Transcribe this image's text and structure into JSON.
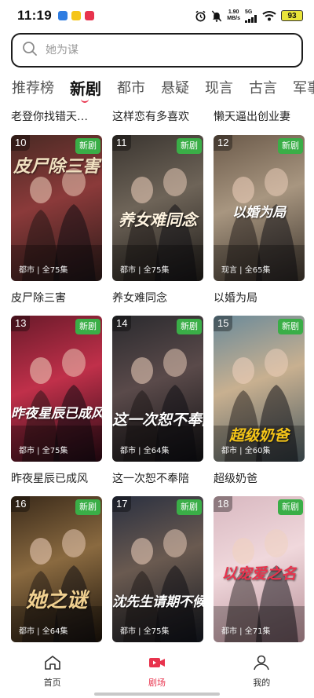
{
  "status_bar": {
    "time": "11:19",
    "net_speed_value": "1.90",
    "net_speed_unit": "MB/s",
    "signal_label": "5G",
    "battery": "93",
    "app_badge_colors": [
      "#2f7de1",
      "#f5c518",
      "#e8334d"
    ]
  },
  "search": {
    "placeholder": "她为谋",
    "icon": "search-icon"
  },
  "tabs": [
    {
      "label": "推荐榜",
      "active": false
    },
    {
      "label": "新剧",
      "active": true
    },
    {
      "label": "都市",
      "active": false
    },
    {
      "label": "悬疑",
      "active": false
    },
    {
      "label": "现言",
      "active": false
    },
    {
      "label": "古言",
      "active": false
    },
    {
      "label": "军事",
      "active": false
    }
  ],
  "top_row_titles": [
    "老登你找错天…",
    "这样恋有多喜欢",
    "懒天逼出创业妻"
  ],
  "badge_new": "新剧",
  "cards": [
    {
      "rank": "10",
      "genre": "都市",
      "episodes": "全75集",
      "title": "皮尸除三害",
      "art_text": "皮尸除三害",
      "colors": [
        "#4a2a24",
        "#8b3a3a",
        "#2a1a18"
      ],
      "art_color": "#f0e0c0"
    },
    {
      "rank": "11",
      "genre": "都市",
      "episodes": "全75集",
      "title": "养女难同念",
      "art_text": "养女难同念",
      "colors": [
        "#3a3530",
        "#6e6458",
        "#1e1b18"
      ],
      "art_color": "#fff4e0"
    },
    {
      "rank": "12",
      "genre": "现言",
      "episodes": "全65集",
      "title": "以婚为局",
      "art_text": "以婚为局",
      "colors": [
        "#6b5a4a",
        "#a89680",
        "#3c342c"
      ],
      "art_color": "#ffffff"
    },
    {
      "rank": "13",
      "genre": "都市",
      "episodes": "全75集",
      "title": "昨夜星辰已成风",
      "art_text": "昨夜星辰已成风",
      "colors": [
        "#6a1a2a",
        "#c0304a",
        "#2a0a14"
      ],
      "art_color": "#ffffff"
    },
    {
      "rank": "14",
      "genre": "都市",
      "episodes": "全64集",
      "title": "这一次恕不奉陪",
      "art_text": "这一次恕不奉陪",
      "colors": [
        "#2a2a2e",
        "#5a4a4a",
        "#101012"
      ],
      "art_color": "#ffffff"
    },
    {
      "rank": "15",
      "genre": "都市",
      "episodes": "全60集",
      "title": "超级奶爸",
      "art_text": "超级奶爸",
      "colors": [
        "#6a8a9a",
        "#c8b090",
        "#4a5a60"
      ],
      "art_color": "#f5c518"
    },
    {
      "rank": "16",
      "genre": "都市",
      "episodes": "全64集",
      "title": "",
      "art_text": "她之谜",
      "colors": [
        "#3a2a1a",
        "#8a6a40",
        "#1a120a"
      ],
      "art_color": "#f0d090"
    },
    {
      "rank": "17",
      "genre": "都市",
      "episodes": "全75集",
      "title": "",
      "art_text": "沈先生请期不候",
      "colors": [
        "#2a3040",
        "#6a5a50",
        "#141820"
      ],
      "art_color": "#ffffff"
    },
    {
      "rank": "18",
      "genre": "都市",
      "episodes": "全71集",
      "title": "",
      "art_text": "以宠爱之名",
      "colors": [
        "#d8b8c0",
        "#f0d8dc",
        "#b89098"
      ],
      "art_color": "#e8334d"
    }
  ],
  "bottom_nav": [
    {
      "label": "首页",
      "icon": "home-icon",
      "active": false
    },
    {
      "label": "剧场",
      "icon": "video-icon",
      "active": true
    },
    {
      "label": "我的",
      "icon": "profile-icon",
      "active": false
    }
  ],
  "accent_color": "#e8334d"
}
